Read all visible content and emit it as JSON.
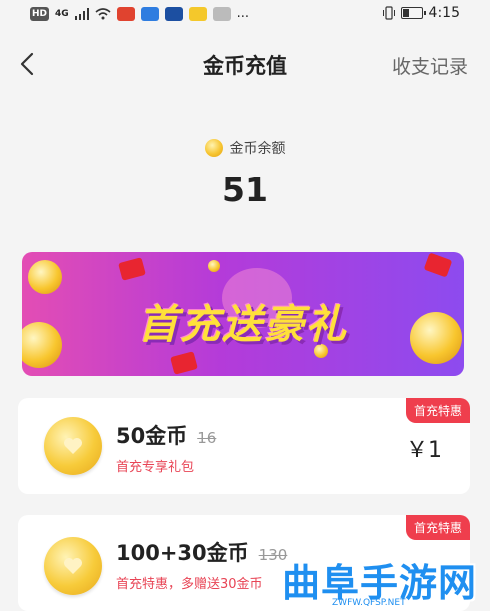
{
  "status_bar": {
    "left_items": [
      "HD",
      "4G",
      "signal-icon",
      "wifi-icon",
      "app-icon-1",
      "app-icon-2",
      "app-icon-3",
      "app-icon-4",
      "app-icon-5",
      "..."
    ],
    "time": "4:15"
  },
  "header": {
    "title": "金币充值",
    "right_action": "收支记录"
  },
  "balance": {
    "label": "金币余额",
    "value": "51"
  },
  "banner": {
    "text": "首充送豪礼"
  },
  "packages": [
    {
      "title": "50金币",
      "original": "16",
      "subtitle": "首充专享礼包",
      "price": "￥1",
      "tag": "首充特惠"
    },
    {
      "title": "100+30金币",
      "original": "130",
      "subtitle": "首充特惠，多赠送30金币",
      "price": "",
      "tag": "首充特惠"
    }
  ],
  "watermark": {
    "text": "曲阜手游网",
    "url": "ZWFW.QFSP.NET"
  },
  "colors": {
    "accent_red": "#ef3e4d",
    "subtitle_red": "#e84455",
    "banner_start": "#e34db4",
    "banner_end": "#8d4bef",
    "watermark_blue": "#1f8ff0"
  }
}
